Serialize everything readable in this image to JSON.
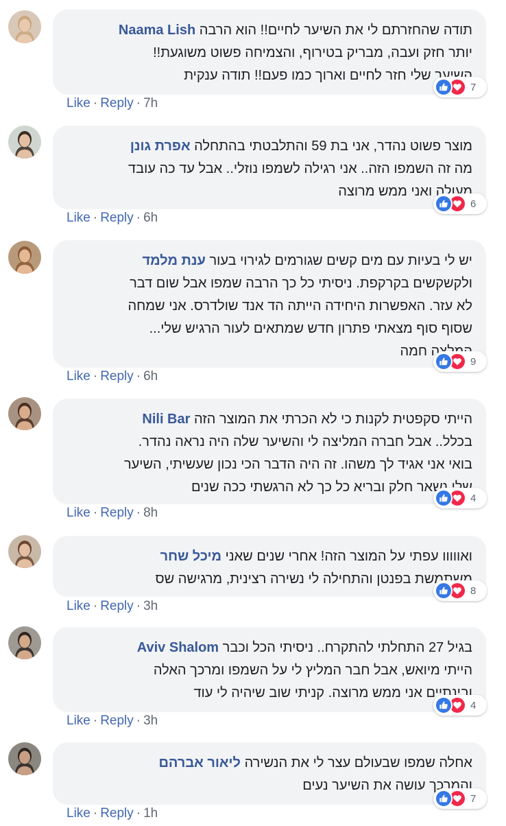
{
  "comments": [
    {
      "author": "Naama Lish",
      "lines": [
        "תודה שהחזרתם לי את השיער לחיים!! הוא הרבה",
        "יותר חזק ועבה, מבריק בטירוף, והצמיחה פשוט משוגעת!!",
        "השיער שלי חזר לחיים וארוך כמו פעם!! תודה ענקית"
      ],
      "reaction_count": "7",
      "like_label": "Like",
      "reply_label": "Reply",
      "time": "7h",
      "avatar_colors": {
        "bg": "#d9c7b8",
        "skin": "#e9c9b0",
        "hair": "#c9a77d"
      }
    },
    {
      "author": "אפרת גונן",
      "lines": [
        "מוצר פשוט נהדר, אני בת 59 והתלבטתי בהתחלה",
        "מה זה השמפו הזה.. אני רגילה לשמפו נוזלי.. אבל עד כה עובד",
        "מעולה ואני ממש מרוצה"
      ],
      "reaction_count": "6",
      "like_label": "Like",
      "reply_label": "Reply",
      "time": "6h",
      "avatar_colors": {
        "bg": "#cfd6cf",
        "skin": "#e3c0a4",
        "hair": "#3a2b24"
      }
    },
    {
      "author": "ענת מלמד",
      "lines": [
        "יש לי בעיות עם מים קשים שגורמים לגירוי בעור",
        "ולקשקשים בקרקפת. ניסיתי כל כך הרבה שמפו אבל שום דבר",
        "לא עזר. האפשרות היחידה הייתה הד אנד שולדרס. אני שמחה",
        "שסוף סוף מצאתי פתרון חדש שמתאים לעור הרגיש שלי...",
        "המלצה חמה"
      ],
      "reaction_count": "9",
      "like_label": "Like",
      "reply_label": "Reply",
      "time": "6h",
      "avatar_colors": {
        "bg": "#b89a7a",
        "skin": "#e5b896",
        "hair": "#8a5a34"
      }
    },
    {
      "author": "Nili Bar",
      "lines": [
        "הייתי סקפטית לקנות כי לא הכרתי את המוצר הזה",
        "בכלל.. אבל חברה המליצה לי והשיער שלה היה נראה נהדר.",
        "בואי אני אגיד לך משהו. זה היה הדבר הכי נכון שעשיתי, השיער",
        "שלי נשאר חלק ובריא כל כך לא הרגשתי ככה שנים"
      ],
      "reaction_count": "4",
      "like_label": "Like",
      "reply_label": "Reply",
      "time": "8h",
      "avatar_colors": {
        "bg": "#a89282",
        "skin": "#d9ad8c",
        "hair": "#4a2e20"
      }
    },
    {
      "author": "מיכל שחר",
      "lines": [
        "ואווווו עפתי על המוצר הזה! אחרי שנים שאני",
        "משתמשת בפנטן והתחילה לי נשירה רצינית, מרגישה שס"
      ],
      "reaction_count": "8",
      "like_label": "Like",
      "reply_label": "Reply",
      "time": "3h",
      "avatar_colors": {
        "bg": "#c8b8a8",
        "skin": "#e2bea2",
        "hair": "#6b4630"
      }
    },
    {
      "author": "Aviv Shalom",
      "lines": [
        "בגיל 27 התחלתי להתקרח.. ניסיתי הכל וכבר",
        "הייתי מיואש, אבל חבר המליץ לי על השמפו ומרכך האלה",
        "ובינתיים אני ממש מרוצה. קניתי שוב שיהיה לי עוד"
      ],
      "reaction_count": "4",
      "like_label": "Like",
      "reply_label": "Reply",
      "time": "3h",
      "avatar_colors": {
        "bg": "#9e9a93",
        "skin": "#d3a98a",
        "hair": "#2e2520"
      }
    },
    {
      "author": "ליאור אברהם",
      "lines": [
        "אחלה שמפו שבעולם עצר לי את הנשירה",
        "והמרכך עושה את השיער נעים"
      ],
      "reaction_count": "7",
      "like_label": "Like",
      "reply_label": "Reply",
      "time": "1h",
      "avatar_colors": {
        "bg": "#8a8680",
        "skin": "#c89f84",
        "hair": "#2b2420"
      }
    }
  ]
}
